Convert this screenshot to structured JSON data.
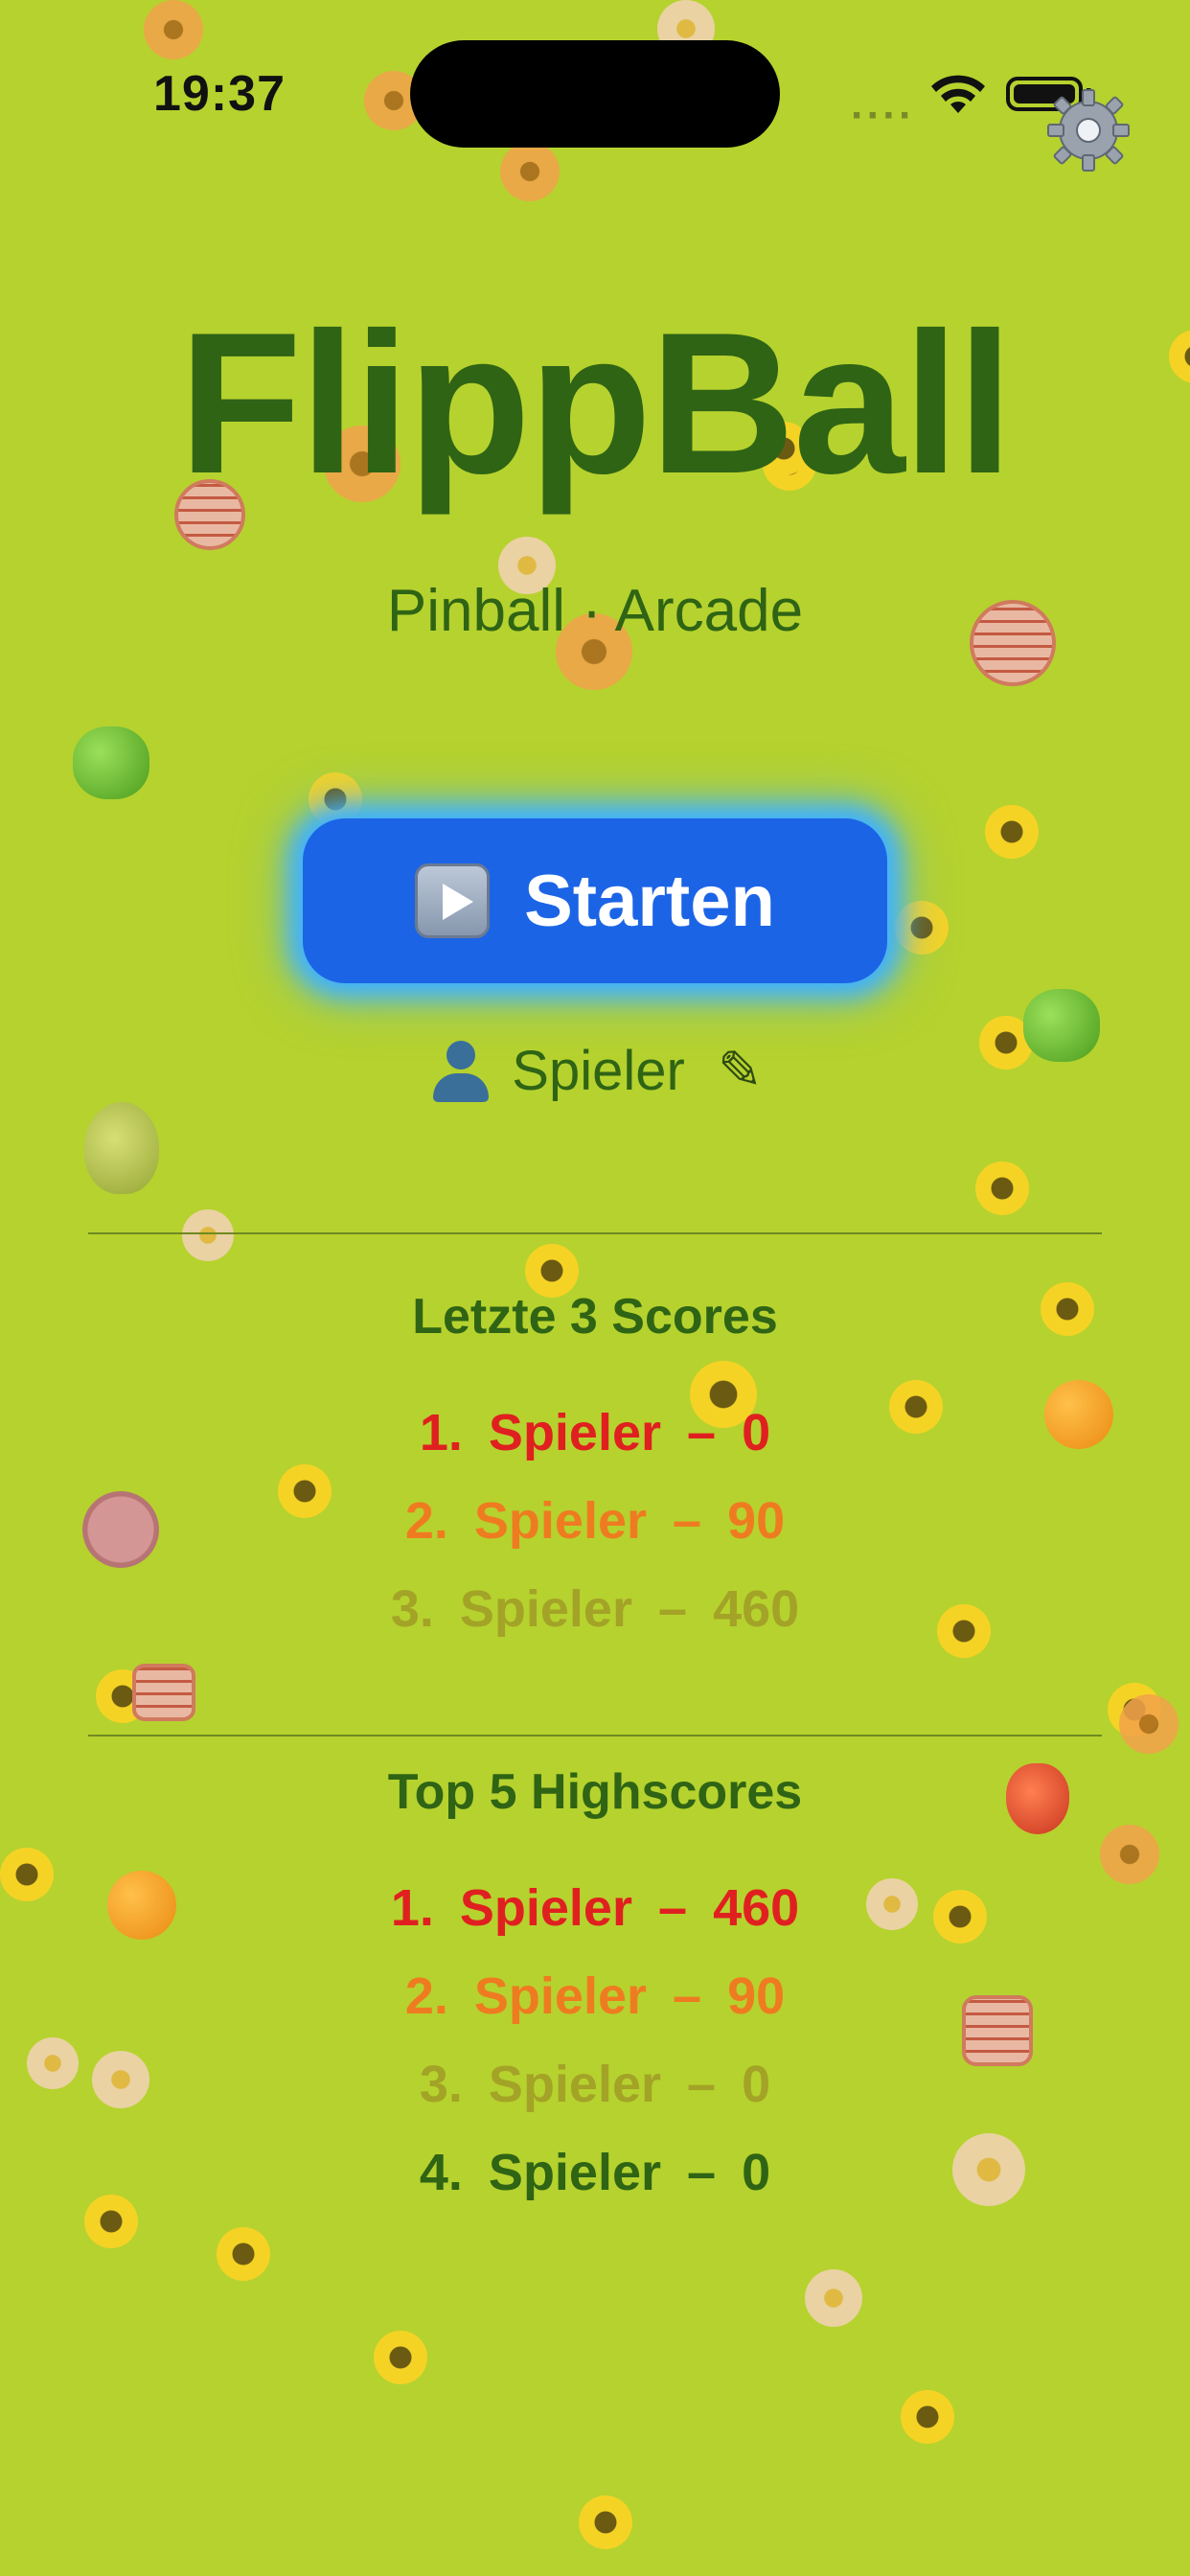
{
  "status_bar": {
    "time": "19:37",
    "signal": "····"
  },
  "app": {
    "title": "FlippBall",
    "subtitle": "Pinball · Arcade"
  },
  "start_button": {
    "label": "Starten",
    "icon": "play-icon"
  },
  "player": {
    "name": "Spieler",
    "icon": "avatar-icon",
    "edit_icon": "pencil-icon",
    "edit_glyph": "✎"
  },
  "recent_scores": {
    "title": "Letzte 3 Scores",
    "items": [
      {
        "rank": "1.",
        "name": "Spieler",
        "sep": "–",
        "score": "0"
      },
      {
        "rank": "2.",
        "name": "Spieler",
        "sep": "–",
        "score": "90"
      },
      {
        "rank": "3.",
        "name": "Spieler",
        "sep": "–",
        "score": "460"
      }
    ]
  },
  "highscores": {
    "title": "Top 5 Highscores",
    "items": [
      {
        "rank": "1.",
        "name": "Spieler",
        "sep": "–",
        "score": "460"
      },
      {
        "rank": "2.",
        "name": "Spieler",
        "sep": "–",
        "score": "90"
      },
      {
        "rank": "3.",
        "name": "Spieler",
        "sep": "–",
        "score": "0"
      },
      {
        "rank": "4.",
        "name": "Spieler",
        "sep": "–",
        "score": "0"
      }
    ]
  },
  "colors": {
    "background": "#b6d22e",
    "title": "#2f6415",
    "button": "#1c64e6",
    "rank1": "#e02020",
    "rank2": "#ef7b21",
    "rank3": "#a3a327",
    "rank4": "#2f6415"
  }
}
